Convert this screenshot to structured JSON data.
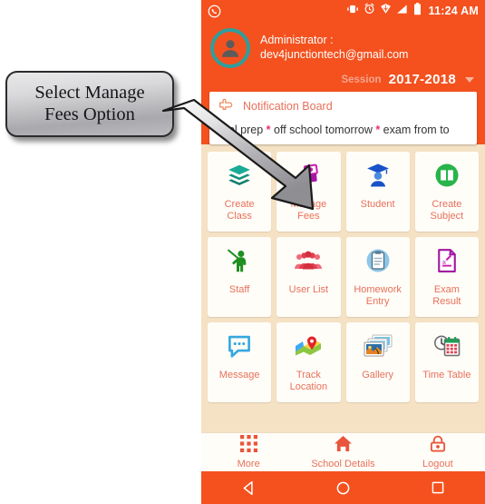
{
  "callout": {
    "line1": "Select Manage",
    "line2": "Fees Option",
    "arrow_points_to": "Manage Fees"
  },
  "phone": {
    "statusbar": {
      "app_icon": "whatsapp-icon",
      "icons": [
        "vibrate-icon",
        "alarm-icon",
        "gps-icon",
        "signal-icon",
        "battery-icon"
      ],
      "time": "11:24 AM"
    },
    "header": {
      "avatar": "user-avatar-icon",
      "user_label": "Administrator :",
      "email": "dev4junctiontech@gmail.com",
      "session_label": "Session",
      "session_value": "2017-2018",
      "session_caret": "chevron-down-icon",
      "accent": "#f4511e",
      "avatar_ring": "#2f9e9e"
    },
    "notification": {
      "icon": "pointing-hand-icon",
      "title": "Notification Board",
      "ticker_pre": "ool prep ",
      "star1": "*",
      "ticker_mid": " off school tomorrow ",
      "star2": "*",
      "ticker_post": " exam from to"
    },
    "grid": {
      "label_color": "#e8705a",
      "items": [
        {
          "label_line1": "Create",
          "label_line2": "Class",
          "icon": "layers-icon"
        },
        {
          "label_line1": "Manage",
          "label_line2": "Fees",
          "icon": "money-icon"
        },
        {
          "label_line1": "Student",
          "label_line2": "",
          "icon": "graduate-icon"
        },
        {
          "label_line1": "Create",
          "label_line2": "Subject",
          "icon": "book-icon"
        },
        {
          "label_line1": "Staff",
          "label_line2": "",
          "icon": "teacher-icon"
        },
        {
          "label_line1": "User List",
          "label_line2": "",
          "icon": "people-icon"
        },
        {
          "label_line1": "Homework",
          "label_line2": "Entry",
          "icon": "clipboard-icon"
        },
        {
          "label_line1": "Exam",
          "label_line2": "Result",
          "icon": "result-document-icon"
        },
        {
          "label_line1": "Message",
          "label_line2": "",
          "icon": "chat-bubble-icon"
        },
        {
          "label_line1": "Track",
          "label_line2": "Location",
          "icon": "map-pin-icon"
        },
        {
          "label_line1": "Gallery",
          "label_line2": "",
          "icon": "photos-icon"
        },
        {
          "label_line1": "Time Table",
          "label_line2": "",
          "icon": "calendar-clock-icon"
        }
      ]
    },
    "bottombar": {
      "items": [
        {
          "label": "More",
          "icon": "grid-icon"
        },
        {
          "label": "School Details",
          "icon": "home-icon"
        },
        {
          "label": "Logout",
          "icon": "lock-icon"
        }
      ]
    },
    "navbar": {
      "back": "back-triangle-icon",
      "home": "home-circle-icon",
      "recents": "recents-square-icon"
    }
  }
}
